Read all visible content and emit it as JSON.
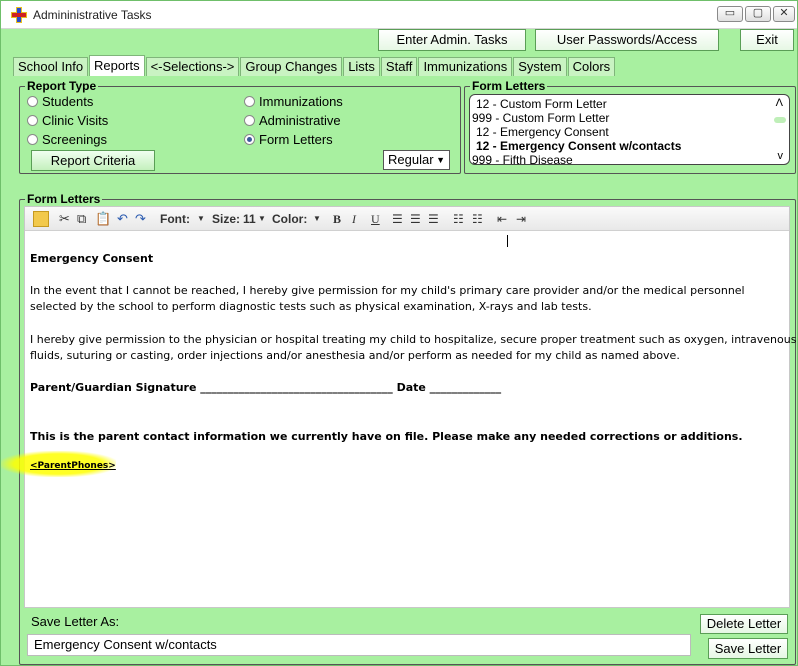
{
  "window": {
    "title": "Admininistrative Tasks",
    "controls": {
      "minimize": "▭",
      "maximize": "▢",
      "close": "✕"
    }
  },
  "top_buttons": {
    "enter_admin": "Enter Admin. Tasks",
    "user_passwords": "User Passwords/Access",
    "exit": "Exit"
  },
  "tabs": [
    {
      "label": "School Info",
      "active": false
    },
    {
      "label": "Reports",
      "active": true
    },
    {
      "label": "<-Selections->",
      "active": false
    },
    {
      "label": "Group Changes",
      "active": false
    },
    {
      "label": "Lists",
      "active": false
    },
    {
      "label": "Staff",
      "active": false
    },
    {
      "label": "Immunizations",
      "active": false
    },
    {
      "label": "System",
      "active": false
    },
    {
      "label": "Colors",
      "active": false
    }
  ],
  "report_type": {
    "legend": "Report Type",
    "options": [
      {
        "label": "Students",
        "checked": false
      },
      {
        "label": "Clinic Visits",
        "checked": false
      },
      {
        "label": "Screenings",
        "checked": false
      },
      {
        "label": "Immunizations",
        "checked": false
      },
      {
        "label": "Administrative",
        "checked": false
      },
      {
        "label": "Form Letters",
        "checked": true
      }
    ],
    "criteria_button": "Report Criteria",
    "format_select": "Regular"
  },
  "form_letters_list": {
    "legend": "Form Letters",
    "items": [
      {
        "label": "12 - Custom Form Letter",
        "bold": false
      },
      {
        "label": "999 - Custom Form Letter",
        "bold": false
      },
      {
        "label": "12 - Emergency Consent",
        "bold": false
      },
      {
        "label": "12 - Emergency Consent w/contacts",
        "bold": true
      },
      {
        "label": "999 - Fifth Disease",
        "bold": false
      }
    ]
  },
  "editor": {
    "legend": "Form Letters",
    "toolbar": {
      "font_label": "Font:",
      "size_label": "Size:",
      "size_value": "11",
      "color_label": "Color:",
      "bold": "B",
      "italic": "I",
      "underline": "U"
    },
    "document": {
      "heading": "Emergency Consent",
      "para1_line1": "In the event that I cannot be reached, I hereby give permission for my child's primary care provider and/or the medical personnel",
      "para1_line2": "selected by the school to perform diagnostic tests such as physical examination, X-rays and lab tests.",
      "para2_line1": "I hereby give permission to the physician or hospital treating my child to hospitalize, secure proper treatment such as oxygen, intravenous",
      "para2_line2": "fluids, suturing or casting, order injections and/or anesthesia and/or perform as needed for my child as named above.",
      "signature_line": "Parent/Guardian Signature ___________________________________   Date _____________",
      "contact_note": "This is the parent contact information we currently have on file.  Please make any needed corrections or additions.",
      "placeholder_tag": "<ParentPhones>"
    }
  },
  "save": {
    "label": "Save Letter As:",
    "value": "Emergency Consent w/contacts",
    "delete_button": "Delete Letter",
    "save_button": "Save Letter"
  },
  "colors": {
    "window_bg": "#a8f0a0",
    "highlight": "#ffff00",
    "checked_radio": "#3a5a9a"
  }
}
